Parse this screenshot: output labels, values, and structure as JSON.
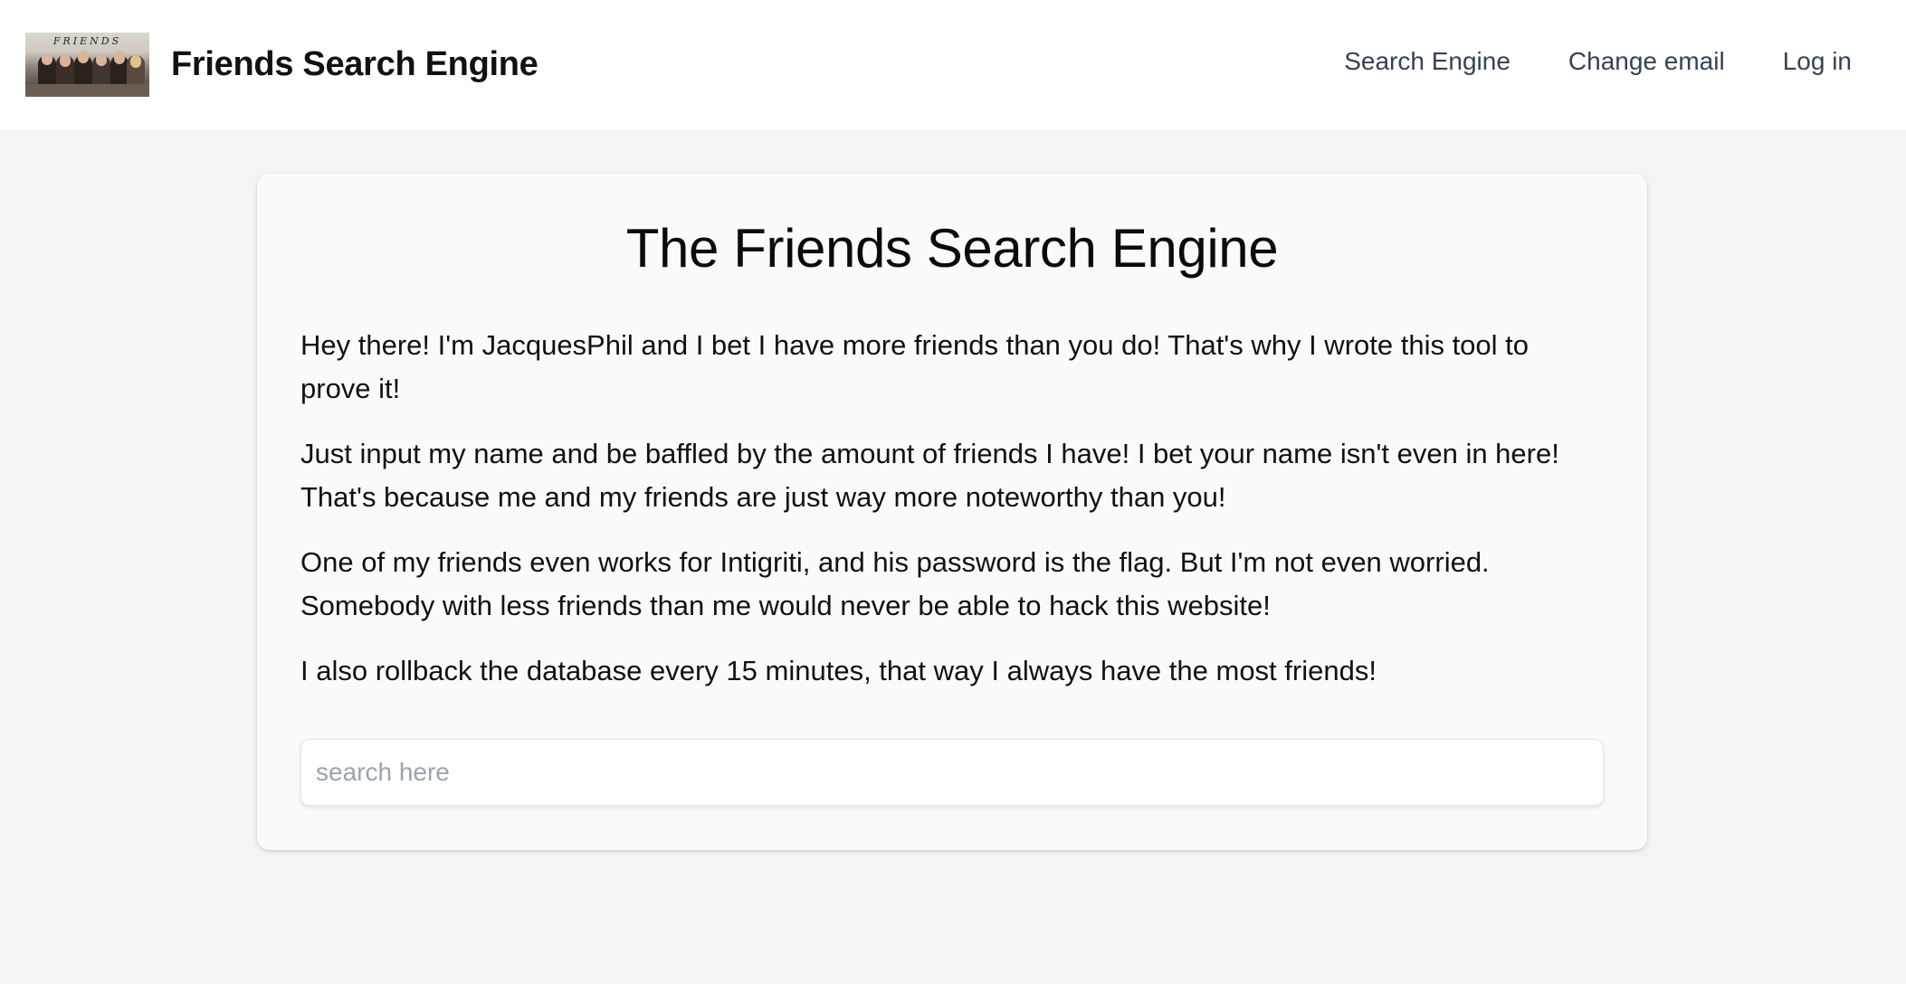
{
  "header": {
    "logo_text": "FRIENDS",
    "brand": "Friends Search Engine",
    "nav": [
      {
        "label": "Search Engine"
      },
      {
        "label": "Change email"
      },
      {
        "label": "Log in"
      }
    ]
  },
  "main": {
    "title": "The Friends Search Engine",
    "paragraphs": [
      "Hey there! I'm JacquesPhil and I bet I have more friends than you do! That's why I wrote this tool to prove it!",
      "Just input my name and be baffled by the amount of friends I have! I bet your name isn't even in here! That's because me and my friends are just way more noteworthy than you!",
      "One of my friends even works for Intigriti, and his password is the flag. But I'm not even worried. Somebody with less friends than me would never be able to hack this website!",
      "I also rollback the database every 15 minutes, that way I always have the most friends!"
    ],
    "search": {
      "value": "",
      "placeholder": "search here"
    }
  },
  "colors": {
    "page_background": "#f3f4f6",
    "header_background": "#ffffff",
    "card_background": "#f9fafb",
    "nav_text": "#374151",
    "placeholder": "#9ca3af"
  }
}
